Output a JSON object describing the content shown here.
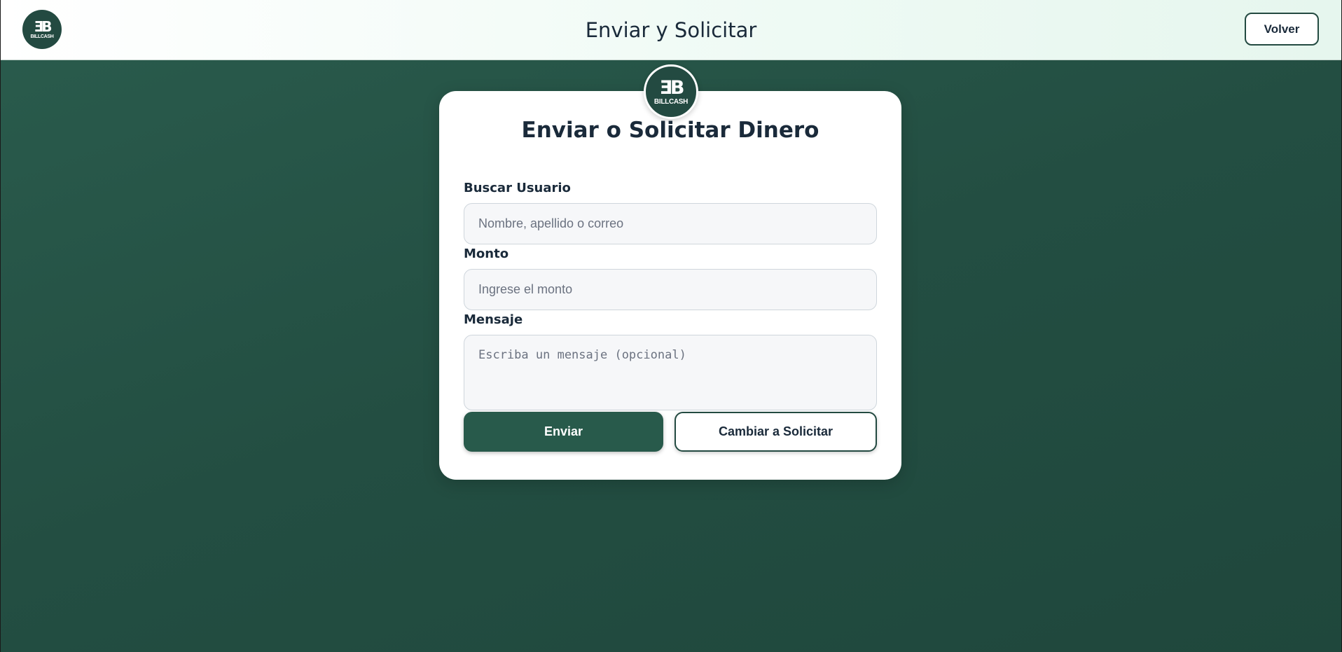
{
  "header": {
    "logo": {
      "monogram": "ƎB",
      "word": "BILLCASH",
      "icon": "billcash-logo"
    },
    "title": "Enviar y Solicitar",
    "back_label": "Volver"
  },
  "card": {
    "logo": {
      "monogram": "ƎB",
      "word": "BILLCASH",
      "icon": "billcash-logo"
    },
    "title": "Enviar o Solicitar Dinero",
    "user_search": {
      "label": "Buscar Usuario",
      "value": "",
      "placeholder": "Nombre, apellido o correo"
    },
    "amount": {
      "label": "Monto",
      "value": "",
      "placeholder": "Ingrese el monto"
    },
    "message": {
      "label": "Mensaje",
      "value": "",
      "placeholder": "Escriba un mensaje (opcional)"
    },
    "send_label": "Enviar",
    "switch_label": "Cambiar a Solicitar"
  },
  "colors": {
    "brand_dark": "#234a41",
    "primary_button": "#285a4b",
    "background_gradient_start": "#2a5c4d",
    "background_gradient_end": "#1f473c",
    "text_dark": "#1a2a3a"
  }
}
